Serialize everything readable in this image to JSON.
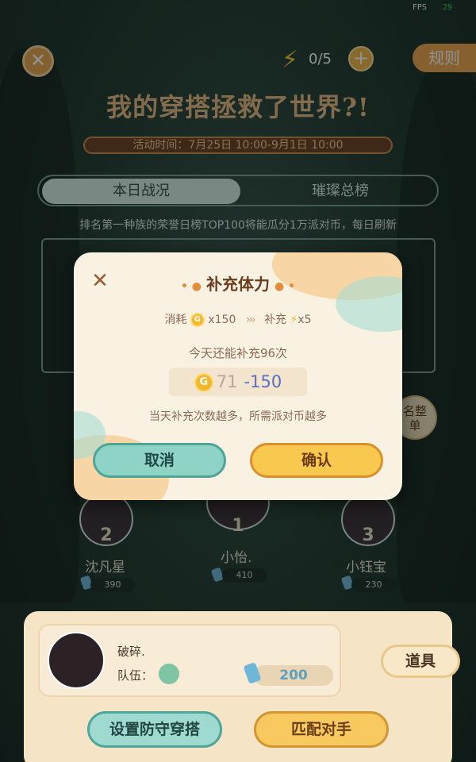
{
  "fps": {
    "label": "FPS",
    "value": "29"
  },
  "header": {
    "close_glyph": "✕",
    "energy_count": "0/5",
    "energy_plus": "+",
    "rules": "规则",
    "title": "我的穿搭拯救了世界?!",
    "period": "活动时间：7月25日 10:00-9月1日 10:00"
  },
  "tabs": {
    "daily": "本日战况",
    "overall": "璀璨总榜"
  },
  "notice": "排名第一种族的荣誉日榜TOP100将能瓜分1万派对币，每日刷新",
  "leaderboard": [
    {
      "rank": "2",
      "name": "沈凡星",
      "score": "390"
    },
    {
      "rank": "1",
      "name": "小怡.",
      "score": "410"
    },
    {
      "rank": "3",
      "name": "小钰宝",
      "score": "230"
    }
  ],
  "peek_button": "名整\n单",
  "player": {
    "name": "破碎.",
    "team_label": "队伍：",
    "power": "200"
  },
  "buttons": {
    "items": "道具",
    "set_defense": "设置防守穿搭",
    "match": "匹配对手"
  },
  "modal": {
    "title": "补充体力",
    "consume_label": "消耗",
    "consume_amount": "x150",
    "arrows": "›››",
    "refill_label": "补充",
    "refill_amount": "x5",
    "remaining_text": "今天还能补充96次",
    "balance": "71",
    "cost": "-150",
    "hint": "当天补充次数越多，所需派对币越多",
    "cancel": "取消",
    "confirm": "确认"
  },
  "colors": {
    "accent_orange": "#efa24d",
    "teal_button": "#8fd3c7",
    "gold_button": "#f9c84f",
    "cost_blue": "#5b6fc2"
  }
}
